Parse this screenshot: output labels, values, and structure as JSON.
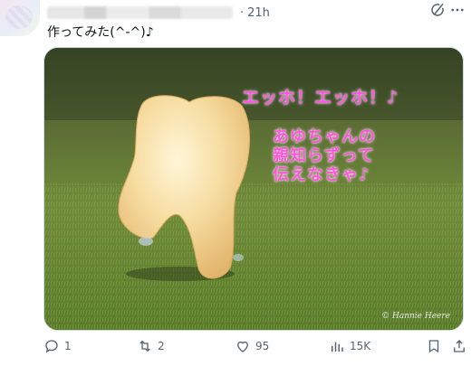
{
  "post": {
    "time": "21h",
    "separator": "·",
    "text": "作ってみた(^-^)♪"
  },
  "media": {
    "caption_line1": "エッホ！エッホ！♪",
    "caption_line2": "あゆちゃんの\n親知らずって\n伝えなきゃ♪",
    "credit": "© Hannie Heere"
  },
  "actions": {
    "replies": "1",
    "reposts": "2",
    "likes": "95",
    "views": "15K"
  },
  "icons": [
    "grok-icon",
    "more-icon",
    "reply-icon",
    "retweet-icon",
    "like-icon",
    "views-icon",
    "bookmark-icon",
    "share-icon"
  ]
}
